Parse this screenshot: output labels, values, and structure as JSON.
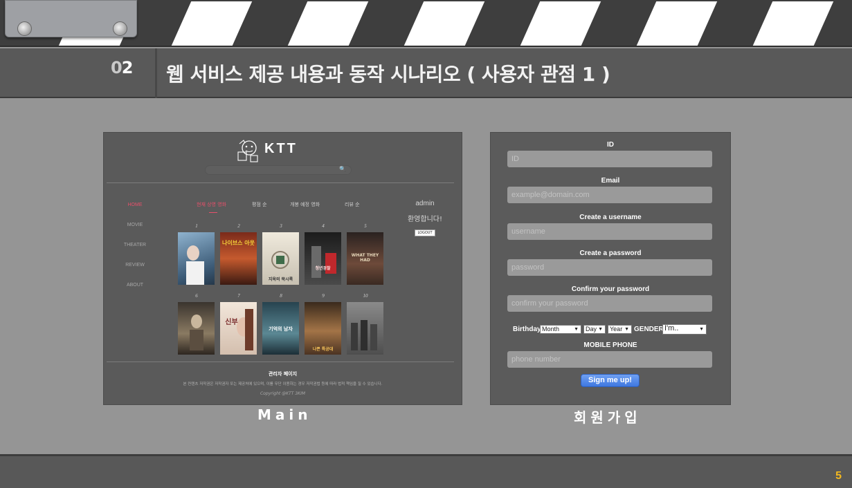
{
  "slide": {
    "section_number": "02",
    "section_number_dim": "0",
    "section_number_bright": "2",
    "title": "웹 서비스 제공 내용과 동작 시나리오 ( 사용자  관점 1 )",
    "page_number": "5",
    "caption_left": "Main",
    "caption_right": "회원가입",
    "accent_color": "#f3b81f"
  },
  "main_screen": {
    "logo_text": "KTT",
    "search_icon": "magnifier-icon",
    "sidebar": [
      {
        "label": "HOME",
        "active": true
      },
      {
        "label": "MOVIE",
        "active": false
      },
      {
        "label": "THEATER",
        "active": false
      },
      {
        "label": "REVIEW",
        "active": false
      },
      {
        "label": "ABOUT",
        "active": false
      }
    ],
    "tabs": [
      {
        "label": "현재 상영 영화",
        "active": true
      },
      {
        "label": "평점 순",
        "active": false
      },
      {
        "label": "개봉 예정 영화",
        "active": false
      },
      {
        "label": "리뷰 순",
        "active": false
      }
    ],
    "user": {
      "name": "admin",
      "welcome": "환영합니다!",
      "logout": "LOGOUT"
    },
    "posters": [
      {
        "rank": "1",
        "color": "#5a7d9c"
      },
      {
        "rank": "2",
        "color": "#b3462c",
        "caption": "나이브스 아웃"
      },
      {
        "rank": "3",
        "color": "#d9d4c8",
        "caption": "지옥의 묵시록"
      },
      {
        "rank": "4",
        "color": "#2e2e2e",
        "caption": "청년경찰"
      },
      {
        "rank": "5",
        "color": "#4a3a32",
        "caption": "WHAT THEY HAD"
      },
      {
        "rank": "6",
        "color": "#5a5148"
      },
      {
        "rank": "7",
        "color": "#e3d3c5",
        "caption": "신부"
      },
      {
        "rank": "8",
        "color": "#3b6271",
        "caption": "기억의 남자"
      },
      {
        "rank": "9",
        "color": "#7b5a3a",
        "caption": "나쁜 특공대"
      },
      {
        "rank": "10",
        "color": "#707070"
      }
    ],
    "footer": {
      "title": "관리자 페이지",
      "notice": "본 컨텐츠 저작권은 저작권자 또는 제공처에 있으며, 이를 무단 이용하는 경우 저작권법 등에 따라 법적 책임을 질 수 있습니다.",
      "copyright": "Copyright @KTT 3KIM"
    }
  },
  "signup_form": {
    "id_label": "ID",
    "id_placeholder": "ID",
    "email_label": "Email",
    "email_placeholder": "example@domain.com",
    "username_label": "Create a username",
    "username_placeholder": "username",
    "password_label": "Create a password",
    "password_placeholder": "password",
    "confirm_label": "Confirm your password",
    "confirm_placeholder": "confirm your password",
    "birthday_label": "Birthday",
    "month_value": "Month",
    "day_value": "Day",
    "year_value": "Year",
    "gender_label": "GENDER",
    "gender_value": "I'm..",
    "phone_label": "MOBILE PHONE",
    "phone_placeholder": "phone number",
    "submit_label": "Sign me up!"
  }
}
